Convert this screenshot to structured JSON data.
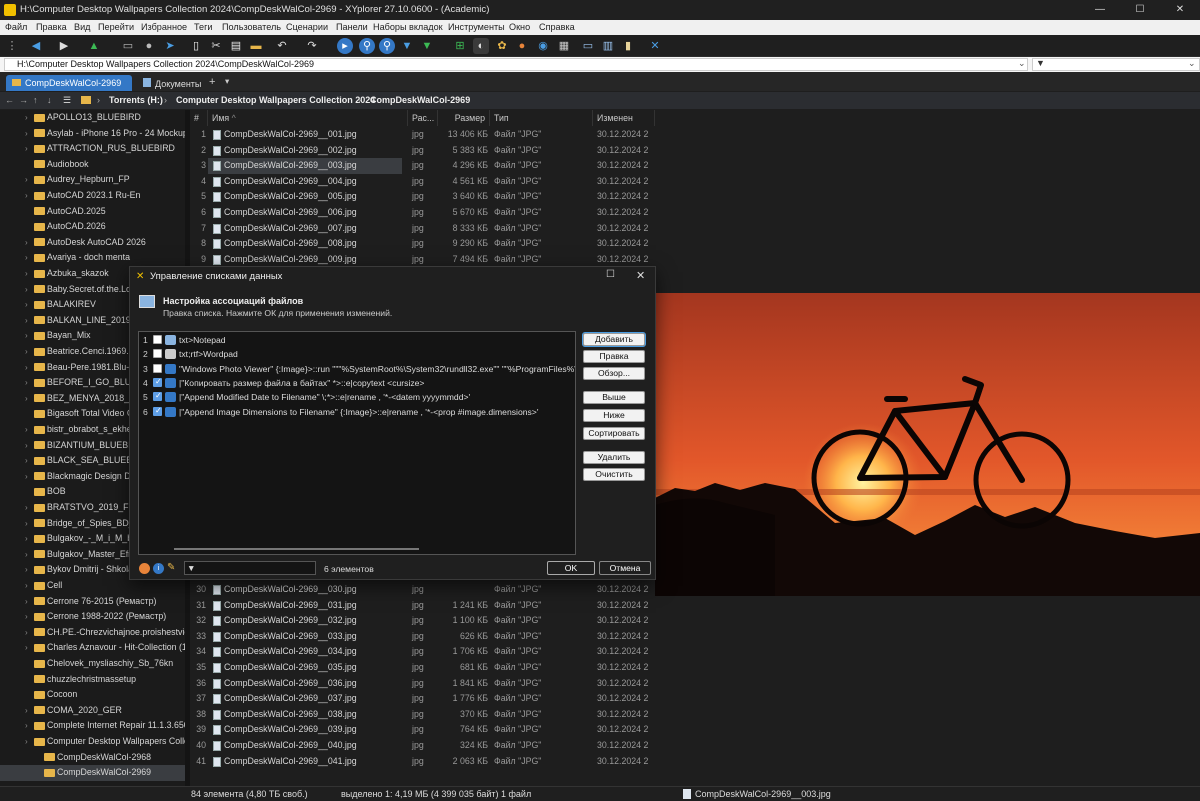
{
  "window": {
    "title": "H:\\Computer Desktop Wallpapers Collection 2024\\CompDeskWalCol-2969 - XYplorer 27.10.0600 - (Academic)",
    "min": "—",
    "max": "☐",
    "close": "✕"
  },
  "menu": [
    "Файл",
    "Правка",
    "Вид",
    "Перейти",
    "Избранное",
    "Теги",
    "Пользователь",
    "Сценарии",
    "Панели",
    "Наборы вкладок",
    "Инструменты",
    "Окно",
    "Справка"
  ],
  "address": "H:\\Computer Desktop Wallpapers Collection 2024\\CompDeskWalCol-2969",
  "tabs": [
    {
      "label": "CompDeskWalCol-2969"
    },
    {
      "label": "Документы"
    }
  ],
  "breadcrumb": [
    "Torrents (H:)",
    "Computer Desktop Wallpapers Collection 2024",
    "CompDeskWalCol-2969"
  ],
  "tree": [
    "APOLLO13_BLUEBIRD",
    "Asylab - iPhone 16 Pro - 24 Mockup",
    "ATTRACTION_RUS_BLUEBIRD",
    "Audiobook",
    "Audrey_Hepburn_FP",
    "AutoCAD 2023.1 Ru-En",
    "AutoCAD.2025",
    "AutoCAD.2026",
    "AutoDesk AutoCAD 2026",
    "Avariya - doch menta",
    "Azbuka_skazok",
    "Baby.Secret.of.the.Lost.",
    "BALAKIREV",
    "BALKAN_LINE_2019_RU",
    "Bayan_Mix",
    "Beatrice.Cenci.1969.Blu",
    "Beau-Pere.1981.Blu-Ray",
    "BEFORE_I_GO_BLUEBIRD",
    "BEZ_MENYA_2018_GER",
    "Bigasoft Total Video Co",
    "bistr_obrabot_s_ekhen",
    "BIZANTIUM_BLUEBIRD",
    "BLACK_SEA_BLUEBIRD",
    "Blackmagic Design DaV",
    "BOB",
    "BRATSTVO_2019_FRA",
    "Bridge_of_Spies_BD_EU",
    "Bulgakov_-_M_i_M_by_F",
    "Bulgakov_Master_Efrem",
    "Bykov Dmitrij - Shkola",
    "Cell",
    "Cerrone 76-2015 (Ремастр)",
    "Cerrone 1988-2022 (Ремастр)",
    "CH.PE.-Chrezvichajnoe.proishestvie.1",
    "Charles Aznavour - Hit-Collection (19",
    "Chelovek_mysliaschiy_Sb_76kn",
    "chuzzlechristmassetup",
    "Cocoon",
    "COMA_2020_GER",
    "Complete Internet Repair 11.1.3.6508",
    "Computer Desktop Wallpapers Collec",
    "CompDeskWalCol-2968",
    "CompDeskWalCol-2969"
  ],
  "columns": {
    "num": "#",
    "name": "Имя",
    "ext": "Рас...",
    "size": "Размер",
    "type": "Тип",
    "modified": "Изменен"
  },
  "files_top": [
    {
      "n": "1",
      "name": "CompDeskWalCol-2969__001.jpg",
      "ext": "jpg",
      "size": "13 406 КБ",
      "type": "Файл \"JPG\"",
      "date": "30.12.2024 2"
    },
    {
      "n": "2",
      "name": "CompDeskWalCol-2969__002.jpg",
      "ext": "jpg",
      "size": "5 383 КБ",
      "type": "Файл \"JPG\"",
      "date": "30.12.2024 2"
    },
    {
      "n": "3",
      "name": "CompDeskWalCol-2969__003.jpg",
      "ext": "jpg",
      "size": "4 296 КБ",
      "type": "Файл \"JPG\"",
      "date": "30.12.2024 2"
    },
    {
      "n": "4",
      "name": "CompDeskWalCol-2969__004.jpg",
      "ext": "jpg",
      "size": "4 561 КБ",
      "type": "Файл \"JPG\"",
      "date": "30.12.2024 2"
    },
    {
      "n": "5",
      "name": "CompDeskWalCol-2969__005.jpg",
      "ext": "jpg",
      "size": "3 640 КБ",
      "type": "Файл \"JPG\"",
      "date": "30.12.2024 2"
    },
    {
      "n": "6",
      "name": "CompDeskWalCol-2969__006.jpg",
      "ext": "jpg",
      "size": "5 670 КБ",
      "type": "Файл \"JPG\"",
      "date": "30.12.2024 2"
    },
    {
      "n": "7",
      "name": "CompDeskWalCol-2969__007.jpg",
      "ext": "jpg",
      "size": "8 333 КБ",
      "type": "Файл \"JPG\"",
      "date": "30.12.2024 2"
    },
    {
      "n": "8",
      "name": "CompDeskWalCol-2969__008.jpg",
      "ext": "jpg",
      "size": "9 290 КБ",
      "type": "Файл \"JPG\"",
      "date": "30.12.2024 2"
    },
    {
      "n": "9",
      "name": "CompDeskWalCol-2969__009.jpg",
      "ext": "jpg",
      "size": "7 494 КБ",
      "type": "Файл \"JPG\"",
      "date": "30.12.2024 2"
    }
  ],
  "files_bottom": [
    {
      "n": "30",
      "name": "CompDeskWalCol-2969__030.jpg",
      "ext": "jpg",
      "size": "",
      "type": "Файл \"JPG\"",
      "date": "30.12.2024 2"
    },
    {
      "n": "31",
      "name": "CompDeskWalCol-2969__031.jpg",
      "ext": "jpg",
      "size": "1 241 КБ",
      "type": "Файл \"JPG\"",
      "date": "30.12.2024 2"
    },
    {
      "n": "32",
      "name": "CompDeskWalCol-2969__032.jpg",
      "ext": "jpg",
      "size": "1 100 КБ",
      "type": "Файл \"JPG\"",
      "date": "30.12.2024 2"
    },
    {
      "n": "33",
      "name": "CompDeskWalCol-2969__033.jpg",
      "ext": "jpg",
      "size": "626 КБ",
      "type": "Файл \"JPG\"",
      "date": "30.12.2024 2"
    },
    {
      "n": "34",
      "name": "CompDeskWalCol-2969__034.jpg",
      "ext": "jpg",
      "size": "1 706 КБ",
      "type": "Файл \"JPG\"",
      "date": "30.12.2024 2"
    },
    {
      "n": "35",
      "name": "CompDeskWalCol-2969__035.jpg",
      "ext": "jpg",
      "size": "681 КБ",
      "type": "Файл \"JPG\"",
      "date": "30.12.2024 2"
    },
    {
      "n": "36",
      "name": "CompDeskWalCol-2969__036.jpg",
      "ext": "jpg",
      "size": "1 841 КБ",
      "type": "Файл \"JPG\"",
      "date": "30.12.2024 2"
    },
    {
      "n": "37",
      "name": "CompDeskWalCol-2969__037.jpg",
      "ext": "jpg",
      "size": "1 776 КБ",
      "type": "Файл \"JPG\"",
      "date": "30.12.2024 2"
    },
    {
      "n": "38",
      "name": "CompDeskWalCol-2969__038.jpg",
      "ext": "jpg",
      "size": "370 КБ",
      "type": "Файл \"JPG\"",
      "date": "30.12.2024 2"
    },
    {
      "n": "39",
      "name": "CompDeskWalCol-2969__039.jpg",
      "ext": "jpg",
      "size": "764 КБ",
      "type": "Файл \"JPG\"",
      "date": "30.12.2024 2"
    },
    {
      "n": "40",
      "name": "CompDeskWalCol-2969__040.jpg",
      "ext": "jpg",
      "size": "324 КБ",
      "type": "Файл \"JPG\"",
      "date": "30.12.2024 2"
    },
    {
      "n": "41",
      "name": "CompDeskWalCol-2969__041.jpg",
      "ext": "jpg",
      "size": "2 063 КБ",
      "type": "Файл \"JPG\"",
      "date": "30.12.2024 2"
    }
  ],
  "status": {
    "count": "84 элемента (4,80 ТБ своб.)",
    "selection": "выделено 1: 4,19 МБ (4 399 035 байт) 1 файл",
    "file": "CompDeskWalCol-2969__003.jpg"
  },
  "dialog": {
    "title": "Управление списками данных",
    "heading": "Настройка ассоциаций файлов",
    "subheading": "Правка списка. Нажмите ОК для применения изменений.",
    "items": [
      {
        "n": "1",
        "checked": false,
        "text": "txt>Notepad"
      },
      {
        "n": "2",
        "checked": false,
        "text": "txt;rtf>Wordpad"
      },
      {
        "n": "3",
        "checked": false,
        "text": "\"Windows Photo Viewer\" {:Image}>::run \"\"\"%SystemRoot%\\System32\\rundll32.exe\"\" \"\"%ProgramFiles%\\Window"
      },
      {
        "n": "4",
        "checked": true,
        "text": "|\"Копировать размер файла в байтах\" *>::e|copytext <cursize>"
      },
      {
        "n": "5",
        "checked": true,
        "text": "|\"Append Modified Date to Filename\" \\;*>::e|rename , '*-<datem yyyymmdd>'"
      },
      {
        "n": "6",
        "checked": true,
        "text": "|\"Append Image Dimensions to Filename\" {:Image}>::e|rename , '*-<prop #image.dimensions>'"
      }
    ],
    "buttons": {
      "add": "Добавить",
      "edit": "Правка",
      "browse": "Обзор...",
      "up": "Выше",
      "down": "Ниже",
      "sort": "Сортировать",
      "delete": "Удалить",
      "clear": "Очистить",
      "ok": "OK",
      "cancel": "Отмена"
    },
    "count": "6 элементов",
    "filter_value": ""
  },
  "colors": {
    "accent": "#4a9de3",
    "selection": "#3a3d41",
    "folder": "#e7b64a"
  }
}
